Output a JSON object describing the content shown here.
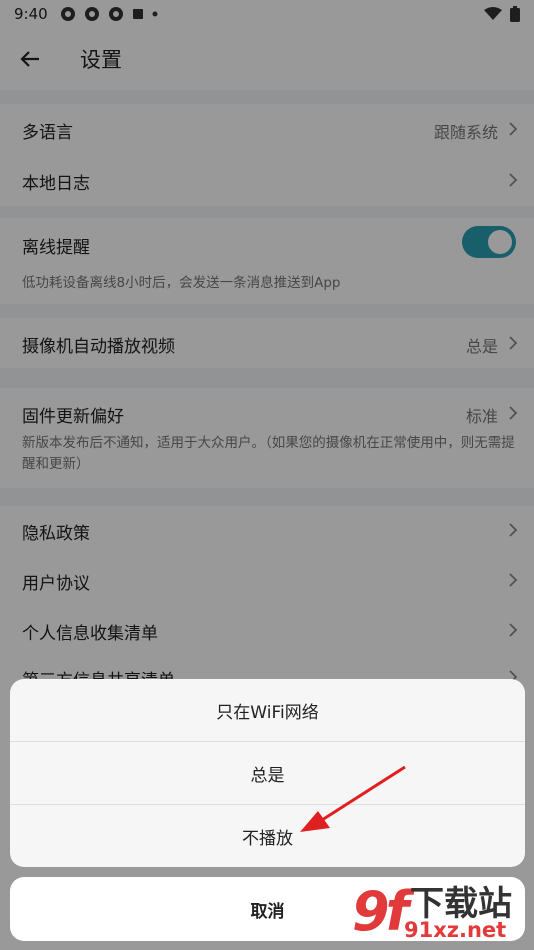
{
  "status_bar": {
    "time": "9:40"
  },
  "header": {
    "title": "设置"
  },
  "settings": {
    "language": {
      "label": "多语言",
      "value": "跟随系统"
    },
    "local_log": {
      "label": "本地日志"
    },
    "offline_alert": {
      "label": "离线提醒",
      "description": "低功耗设备离线8小时后，会发送一条消息推送到App",
      "enabled": true
    },
    "camera_autoplay": {
      "label": "摄像机自动播放视频",
      "value": "总是"
    },
    "firmware_pref": {
      "label": "固件更新偏好",
      "value": "标准",
      "description": "新版本发布后不通知，适用于大众用户。（如果您的摄像机在正常使用中，则无需提醒和更新）"
    },
    "privacy": {
      "label": "隐私政策"
    },
    "user_agreement": {
      "label": "用户协议"
    },
    "personal_info": {
      "label": "个人信息收集清单"
    },
    "third_party": {
      "label": "第三方信息共享清单"
    }
  },
  "action_sheet": {
    "options": [
      "只在WiFi网络",
      "总是",
      "不播放"
    ],
    "cancel": "取消"
  },
  "watermark": {
    "logo": "9f",
    "text": "下载站",
    "url": "91xz.net"
  },
  "colors": {
    "accent": "#2a9db3",
    "annotation_arrow": "#e02020"
  }
}
